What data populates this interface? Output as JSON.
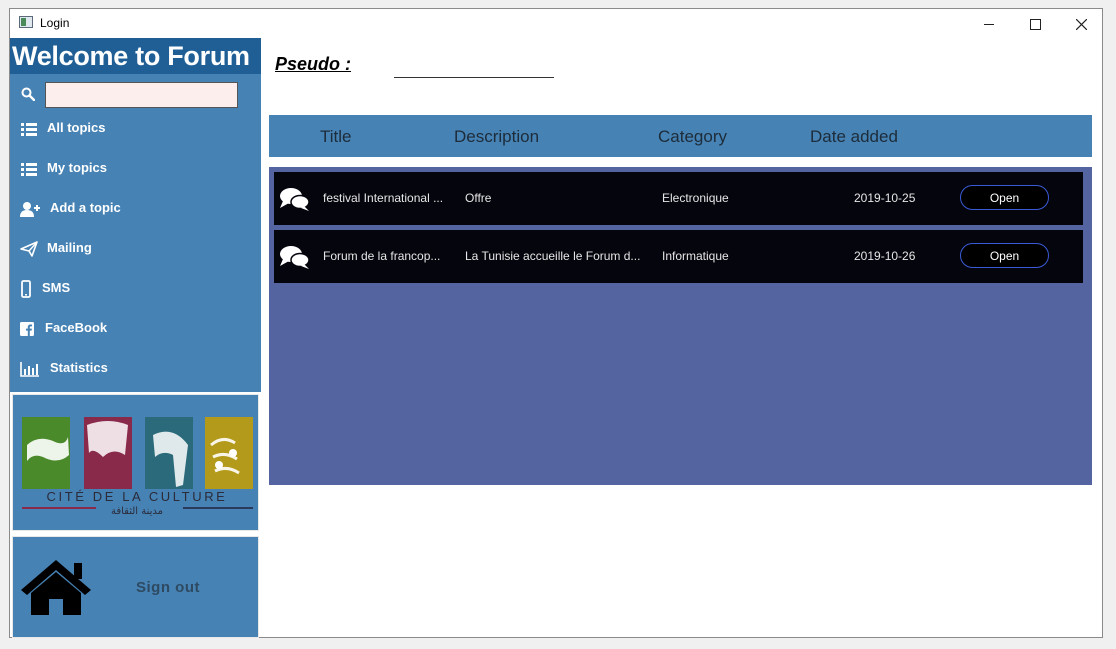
{
  "window": {
    "title": "Login",
    "icon": "window-icon",
    "controls": [
      "minimize-icon",
      "maximize-icon",
      "close-icon"
    ]
  },
  "sidebar": {
    "welcome": "Welcome to Forum",
    "search": {
      "value": "",
      "placeholder": ""
    },
    "items": [
      {
        "label": "All topics",
        "icon": "list-icon"
      },
      {
        "label": "My topics",
        "icon": "list-icon"
      },
      {
        "label": "Add a topic",
        "icon": "user-plus-icon"
      },
      {
        "label": "Mailing",
        "icon": "paper-plane-icon"
      },
      {
        "label": "SMS",
        "icon": "mobile-icon"
      },
      {
        "label": "FaceBook",
        "icon": "facebook-icon"
      },
      {
        "label": "Statistics",
        "icon": "bar-chart-icon"
      }
    ],
    "logo": {
      "text": "CITÉ DE LA CULTURE",
      "arabic": "مدينة الثقافة"
    },
    "signout_label": "Sign out"
  },
  "main": {
    "pseudo_label": "Pseudo  :",
    "pseudo_value": "",
    "columns": [
      "Title",
      "Description",
      "Category",
      "Date added"
    ],
    "topics": [
      {
        "title": "festival International ...",
        "description": "Offre",
        "category": "Electronique",
        "date": "2019-10-25",
        "action": "Open"
      },
      {
        "title": "Forum de la francop...",
        "description": "La Tunisie accueille le Forum d...",
        "category": "Informatique",
        "date": "2019-10-26",
        "action": "Open"
      }
    ]
  },
  "colors": {
    "sidebar": "#4682b4",
    "welcome_bar": "#1f5f96",
    "list_area": "#5464a0",
    "row": "#05050d",
    "open_border": "#3a5bd6"
  }
}
